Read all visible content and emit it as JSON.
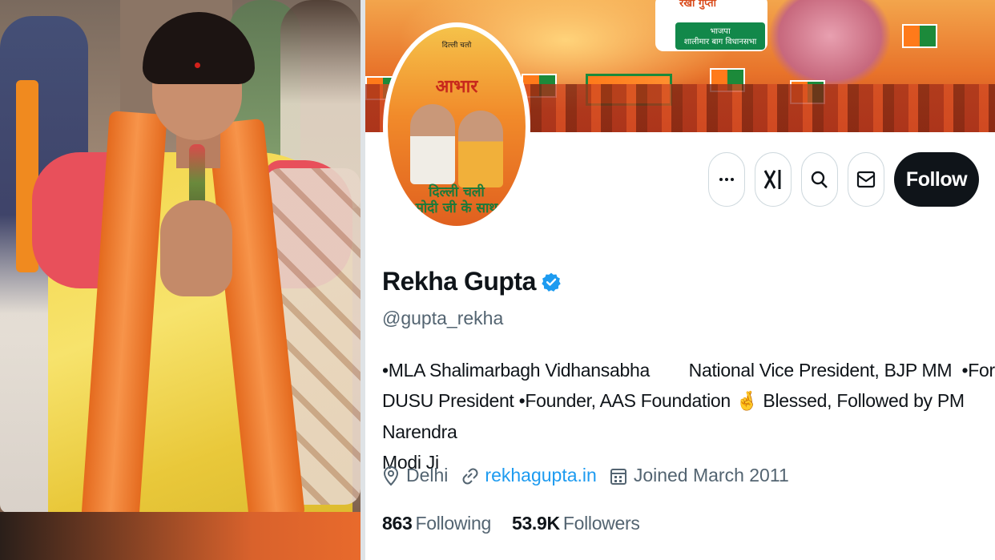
{
  "banner": {
    "sign_title": "रेखा गुप्ता",
    "sign_party": "भाजपा",
    "sign_constituency": "शालीमार बाग विधानसभा"
  },
  "avatar": {
    "top_text": "दिल्ली चलो",
    "big_text": "आभार",
    "bottom_line1": "दिल्ली चली",
    "bottom_line2": "मोदी जी के साथ"
  },
  "actions": {
    "more_icon": "more-icon",
    "grok_icon": "grok-icon",
    "search_icon": "search-icon",
    "message_icon": "message-icon",
    "follow_label": "Follow"
  },
  "profile": {
    "name": "Rekha Gupta",
    "handle": "@gupta_rekha",
    "verified": true,
    "verified_color": "#1d9bf0",
    "bio_line1": "•MLA Shalimarbagh Vidhansabha        National Vice President, BJP MM  •Former",
    "bio_line2_a": "DUSU President •Founder, AAS Foundation ",
    "bio_emoji": "🤞",
    "bio_line2_b": "Blessed, Followed by PM Narendra",
    "bio_line3": "Modi Ji",
    "location": "Delhi",
    "website": "rekhagupta.in",
    "joined": "Joined March 2011",
    "following_count": "863",
    "following_label": "Following",
    "followers_count": "53.9K",
    "followers_label": "Followers",
    "link_color": "#1d9bf0"
  }
}
